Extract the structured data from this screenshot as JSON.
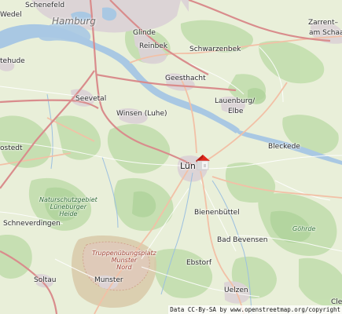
{
  "map": {
    "labels": {
      "schenefeld": "Schenefeld",
      "hamburg": "Hamburg",
      "wedel": "Wedel",
      "glinde": "Glinde",
      "reinbek": "Reinbek",
      "schwarzenbek": "Schwarzenbek",
      "zarrentin": "Zarrent–",
      "am_schaal": "am Schaa",
      "buxtehude": "tehude",
      "geesthacht": "Geesthacht",
      "seevetal": "Seevetal",
      "lauenburg": "Lauenburg/",
      "elbe": "Elbe",
      "winsen": "Winsen (Luhe)",
      "bleckede": "Bleckede",
      "tostedt": "ostedt",
      "lueneburg": "Lün",
      "naturschutzgebiet": "Naturschutzgebiet",
      "lueneburger": "Lüneburger",
      "heide": "Heide",
      "bienenbuettel": "Bienenbüttel",
      "schneverdingen": "Schneverdingen",
      "goehrde": "Göhrde",
      "bad_bevensen": "Bad Bevensen",
      "truppen1": "Truppenübungsplatz",
      "truppen2": "Munster",
      "truppen3": "Nord",
      "munster": "Munster",
      "ebstorf": "Ebstorf",
      "soltau": "Soltau",
      "uelzen": "Uelzen",
      "cle": "Cle"
    },
    "marker": "house-marker-icon"
  },
  "attribution": "Data CC-By-SA by www.openstreetmap.org/copyright",
  "colors": {
    "land": "#e9efd9",
    "forest": "#bcd9a6",
    "urban": "#dcd3d6",
    "water": "#a9c8e3",
    "heath": "#d8c9a8",
    "military": "#e2c7bf",
    "motorway": "#d98c8c",
    "trunk": "#e8a89c",
    "marker_roof": "#e0291e"
  }
}
